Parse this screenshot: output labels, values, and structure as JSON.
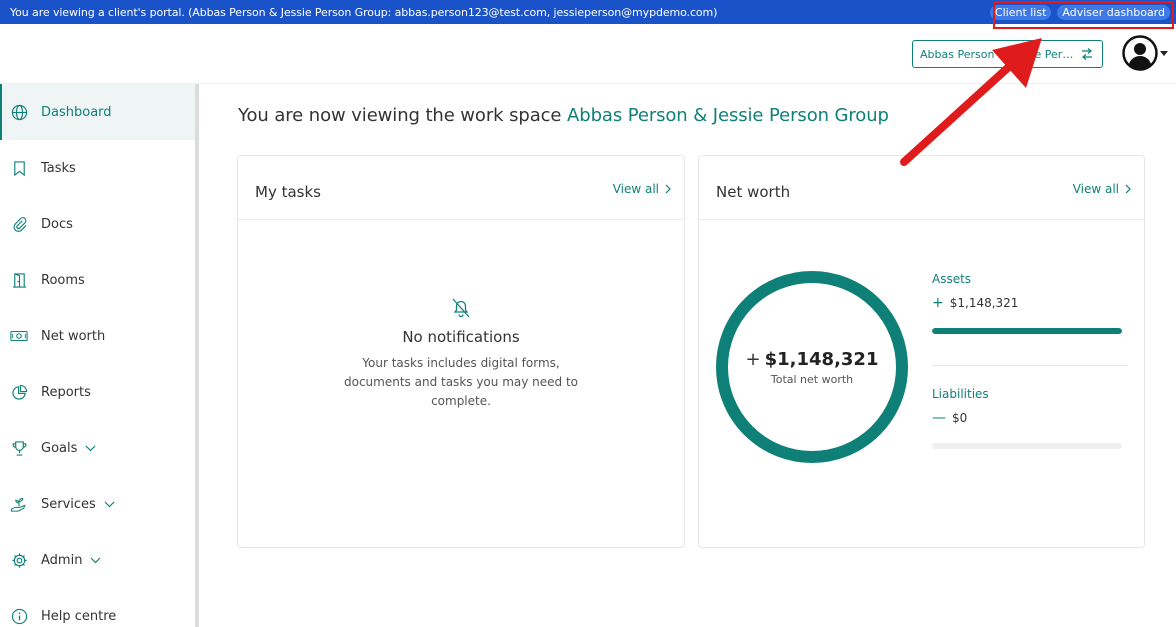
{
  "banner": {
    "text": "You are viewing a client's portal. (Abbas Person & Jessie Person Group:  abbas.person123@test.com, jessieperson@mypdemo.com)",
    "client_list": "Client list",
    "adviser_dashboard": "Adviser dashboard"
  },
  "header": {
    "workspace_switch": "Abbas Person & Jessie Person Group"
  },
  "sidebar": {
    "items": [
      {
        "label": "Dashboard",
        "icon": "globe-icon"
      },
      {
        "label": "Tasks",
        "icon": "bookmark-icon"
      },
      {
        "label": "Docs",
        "icon": "paperclip-icon"
      },
      {
        "label": "Rooms",
        "icon": "door-icon"
      },
      {
        "label": "Net worth",
        "icon": "money-icon"
      },
      {
        "label": "Reports",
        "icon": "pie-chart-icon"
      },
      {
        "label": "Goals",
        "icon": "trophy-icon"
      },
      {
        "label": "Services",
        "icon": "hand-plant-icon"
      },
      {
        "label": "Admin",
        "icon": "gear-icon"
      },
      {
        "label": "Help centre",
        "icon": "info-icon"
      }
    ]
  },
  "main": {
    "title_prefix": "You are now viewing the work space",
    "workspace_name": "Abbas Person & Jessie Person Group"
  },
  "tasks": {
    "title": "My tasks",
    "view_all": "View all",
    "empty_title": "No notifications",
    "empty_text": "Your tasks includes digital forms, documents and tasks you may need to complete."
  },
  "net_worth": {
    "title": "Net worth",
    "view_all": "View all",
    "total_sign": "+",
    "total_value": "$1,148,321",
    "total_label": "Total net worth",
    "assets_label": "Assets",
    "assets_sign": "+",
    "assets_value": "$1,148,321",
    "assets_fraction": 1.0,
    "liabilities_label": "Liabilities",
    "liabilities_sign": "—",
    "liabilities_value": "$0",
    "liabilities_fraction": 0.0
  },
  "colors": {
    "accent": "#0f8078",
    "banner": "#1a53c9",
    "annotation": "#e01b1b"
  }
}
